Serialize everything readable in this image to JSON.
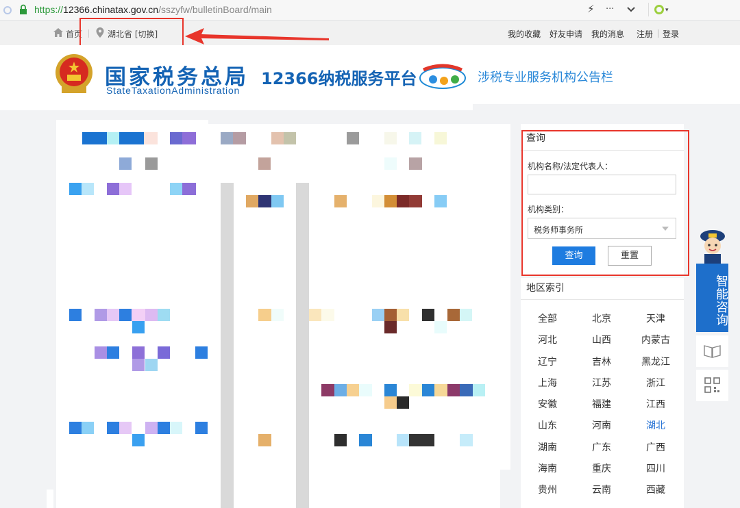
{
  "browser": {
    "url_protocol": "https://",
    "url_host": "12366.chinatax.gov.cn",
    "url_path": "/sszyfw/bulletinBoard/main",
    "toolbar_icons": [
      "lightning-icon",
      "more-icon",
      "chevron-down-icon",
      "search-engine-icon"
    ]
  },
  "topnav": {
    "home": "首页",
    "region": "湖北省",
    "switch": "[切换]",
    "links": [
      "我的收藏",
      "好友申请",
      "我的消息",
      "注册",
      "登录"
    ]
  },
  "header": {
    "logo_cn": "国家税务总局",
    "logo_en": "StateTaxationAdministration",
    "platform": "12366纳税服务平台",
    "subtitle": "涉税专业服务机构公告栏"
  },
  "query": {
    "title": "查询",
    "name_label": "机构名称/法定代表人：",
    "name_value": "",
    "type_label": "机构类别：",
    "type_value": "税务师事务所",
    "submit": "查询",
    "reset": "重置"
  },
  "regions": {
    "title": "地区索引",
    "items": [
      "全部",
      "北京",
      "天津",
      "河北",
      "山西",
      "内蒙古",
      "辽宁",
      "吉林",
      "黑龙江",
      "上海",
      "江苏",
      "浙江",
      "安徽",
      "福建",
      "江西",
      "山东",
      "河南",
      "湖北",
      "湖南",
      "广东",
      "广西",
      "海南",
      "重庆",
      "四川",
      "贵州",
      "云南",
      "西藏"
    ],
    "active": "湖北"
  },
  "side_widgets": {
    "assistant": "智能咨询",
    "icons": [
      "book-icon",
      "qrcode-icon"
    ]
  },
  "colors": {
    "brand_blue": "#1463b4",
    "link_blue": "#2d77d6",
    "annotation_red": "#e8352b",
    "button_blue": "#1e7ce0"
  }
}
